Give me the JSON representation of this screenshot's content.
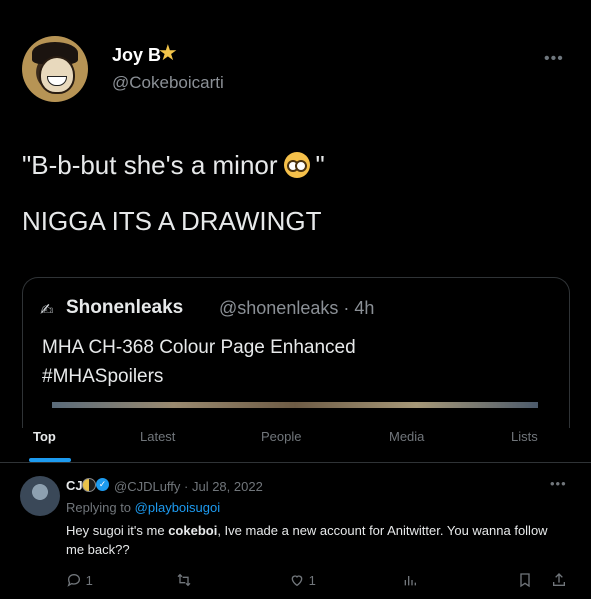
{
  "tweet": {
    "display_name": "Joy B",
    "handle": "@Cokeboicarti",
    "line1_before": "\"B-b-but she's a minor",
    "line1_after": "\"",
    "line2": "NIGGA ITS A DRAWINGT"
  },
  "quote": {
    "name": "Shonenleaks",
    "handle_time": "@shonenleaks · 4h",
    "line1": "MHA CH-368 Colour Page Enhanced",
    "line2": "#MHASpoilers"
  },
  "tabs": [
    "Top",
    "Latest",
    "People",
    "Media",
    "Lists"
  ],
  "active_tab": "Top",
  "reply": {
    "name": "CJ",
    "meta": "@CJDLuffy · Jul 28, 2022",
    "replying_prefix": "Replying to ",
    "replying_mention": "@playboisugoi",
    "text_before": "Hey sugoi it's me ",
    "text_bold": "cokeboi",
    "text_after": ", Ive made a new account for Anitwitter. You wanna follow me back??",
    "reply_count": "1",
    "like_count": "1"
  },
  "colors": {
    "accent": "#1d9bf0",
    "secondary_text": "#71767b",
    "background": "#000000"
  }
}
